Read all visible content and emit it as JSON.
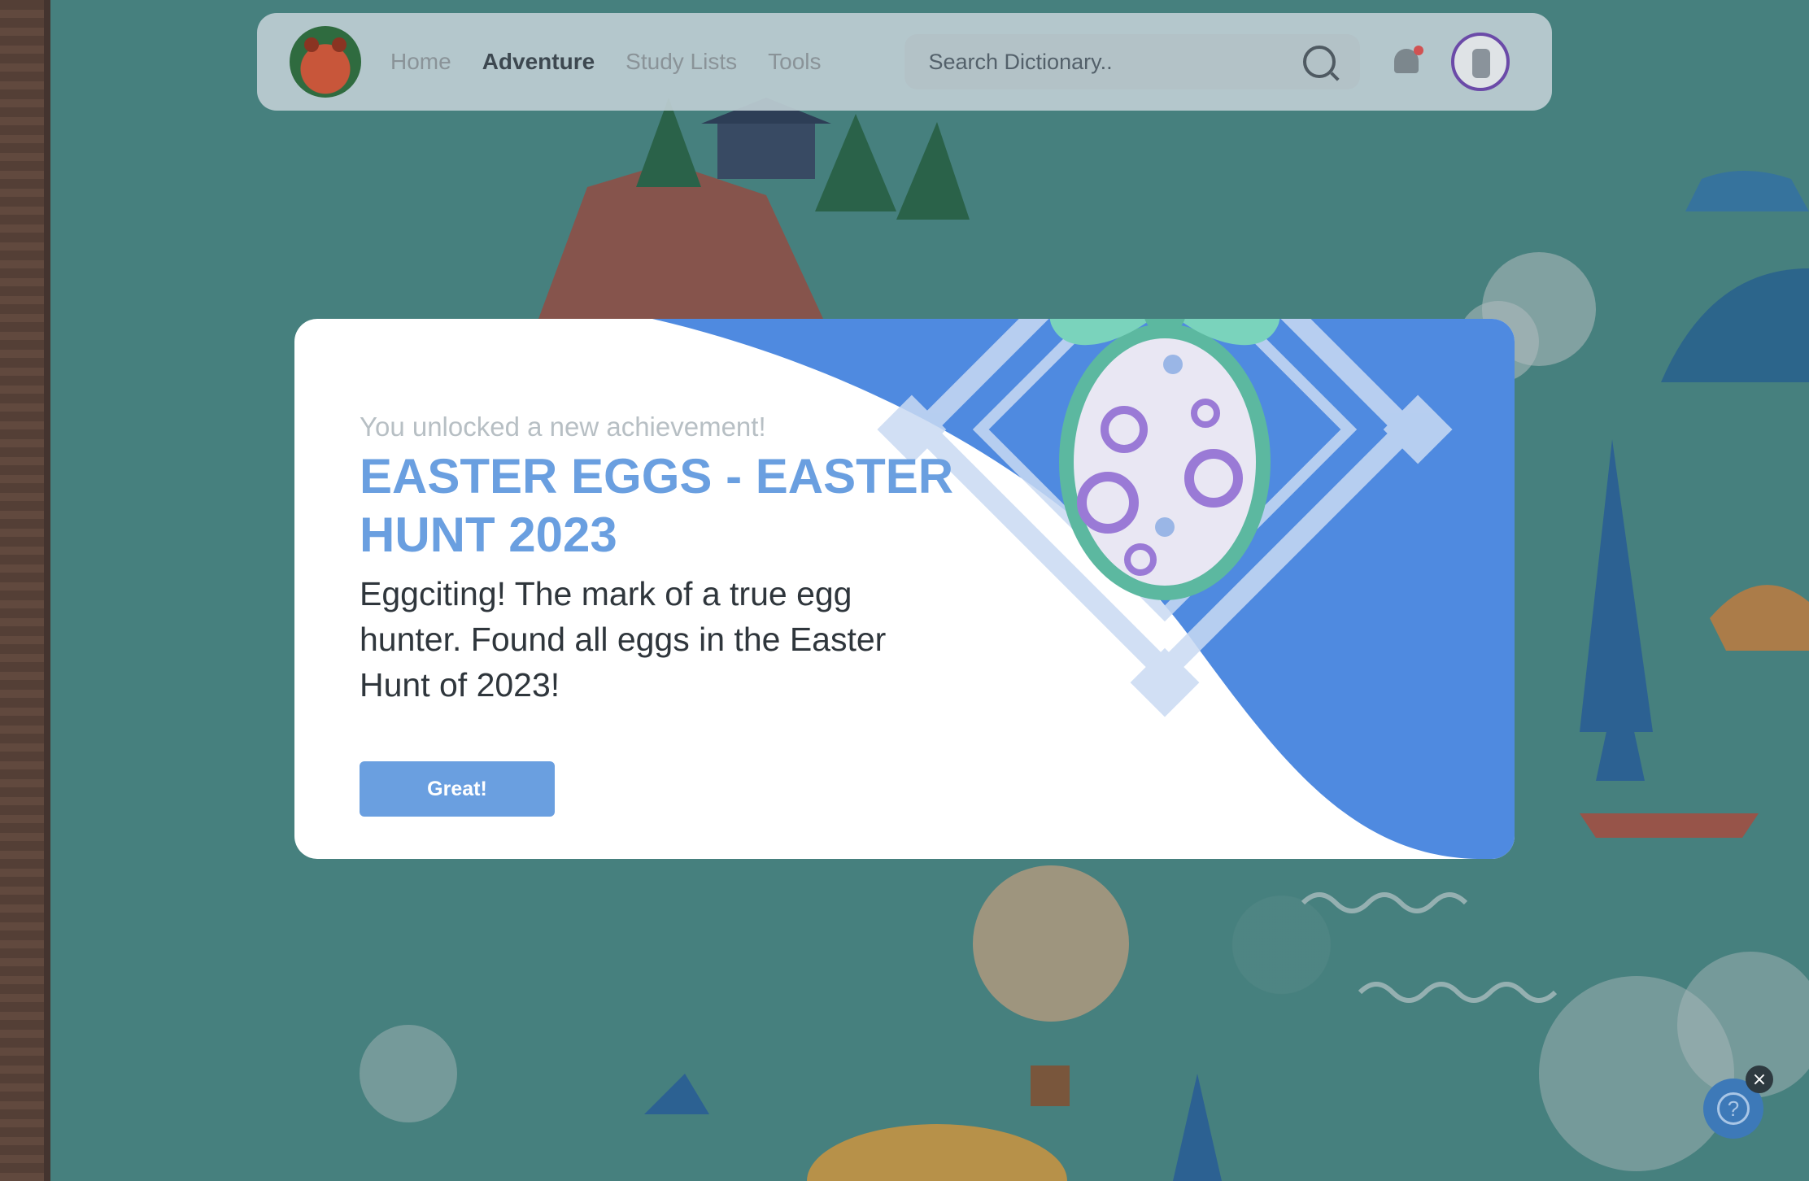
{
  "nav": {
    "links": [
      {
        "label": "Home"
      },
      {
        "label": "Adventure",
        "active": true
      },
      {
        "label": "Study Lists"
      },
      {
        "label": "Tools"
      }
    ],
    "search_placeholder": "Search Dictionary..",
    "notification_dot_color": "#d15252"
  },
  "modal": {
    "subtitle": "You unlocked a new achievement!",
    "title": "EASTER EGGS - EASTER HUNT 2023",
    "description": "Eggciting! The mark of a true egg hunter. Found all eggs in the Easter Hunt of 2023!",
    "button_label": "Great!",
    "accent_color": "#6a9fe0",
    "wave_color": "#4f8ae0"
  },
  "help": {
    "close_glyph": "×",
    "icon_glyph": "?"
  },
  "icons": [
    "logo-icon",
    "search-icon",
    "bell-icon",
    "avatar",
    "egg-badge-icon",
    "help-icon",
    "close-icon"
  ]
}
